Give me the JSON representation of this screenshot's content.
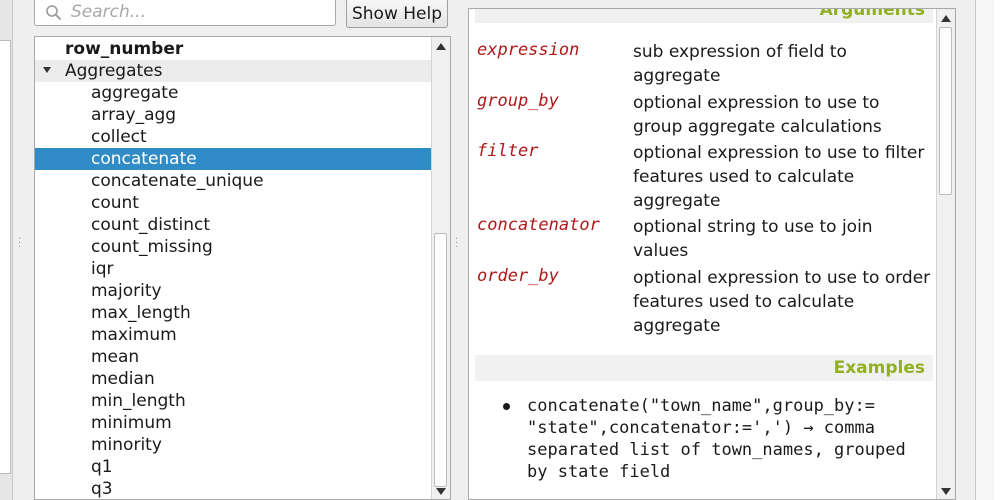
{
  "search": {
    "placeholder": "Search..."
  },
  "help_button": {
    "label": "Show Help"
  },
  "tree": {
    "items": [
      {
        "label": "row_number",
        "level": 0,
        "bold": true
      },
      {
        "label": "Aggregates",
        "level": 0,
        "expanded": true,
        "group": true
      },
      {
        "label": "aggregate",
        "level": 1
      },
      {
        "label": "array_agg",
        "level": 1
      },
      {
        "label": "collect",
        "level": 1
      },
      {
        "label": "concatenate",
        "level": 1,
        "selected": true
      },
      {
        "label": "concatenate_unique",
        "level": 1
      },
      {
        "label": "count",
        "level": 1
      },
      {
        "label": "count_distinct",
        "level": 1
      },
      {
        "label": "count_missing",
        "level": 1
      },
      {
        "label": "iqr",
        "level": 1
      },
      {
        "label": "majority",
        "level": 1
      },
      {
        "label": "max_length",
        "level": 1
      },
      {
        "label": "maximum",
        "level": 1
      },
      {
        "label": "mean",
        "level": 1
      },
      {
        "label": "median",
        "level": 1
      },
      {
        "label": "min_length",
        "level": 1
      },
      {
        "label": "minimum",
        "level": 1
      },
      {
        "label": "minority",
        "level": 1
      },
      {
        "label": "q1",
        "level": 1
      },
      {
        "label": "q3",
        "level": 1
      }
    ]
  },
  "help": {
    "arguments_heading": "Arguments",
    "arguments": [
      {
        "name": "expression",
        "description": "sub expression of field to aggregate"
      },
      {
        "name": "group_by",
        "description": "optional expression to use to group aggregate calculations"
      },
      {
        "name": "filter",
        "description": "optional expression to use to filter features used to calculate aggregate"
      },
      {
        "name": "concatenator",
        "description": "optional string to use to join values"
      },
      {
        "name": "order_by",
        "description": "optional expression to use to order features used to calculate aggregate"
      }
    ],
    "examples_heading": "Examples",
    "examples": [
      "concatenate(\"town_name\",group_by:= \"state\",concatenator:=',') → comma separated list of town_names, grouped by state field"
    ]
  },
  "colors": {
    "selection": "#308cc6",
    "argument_name": "#b01919",
    "section_heading": "#93b023"
  }
}
